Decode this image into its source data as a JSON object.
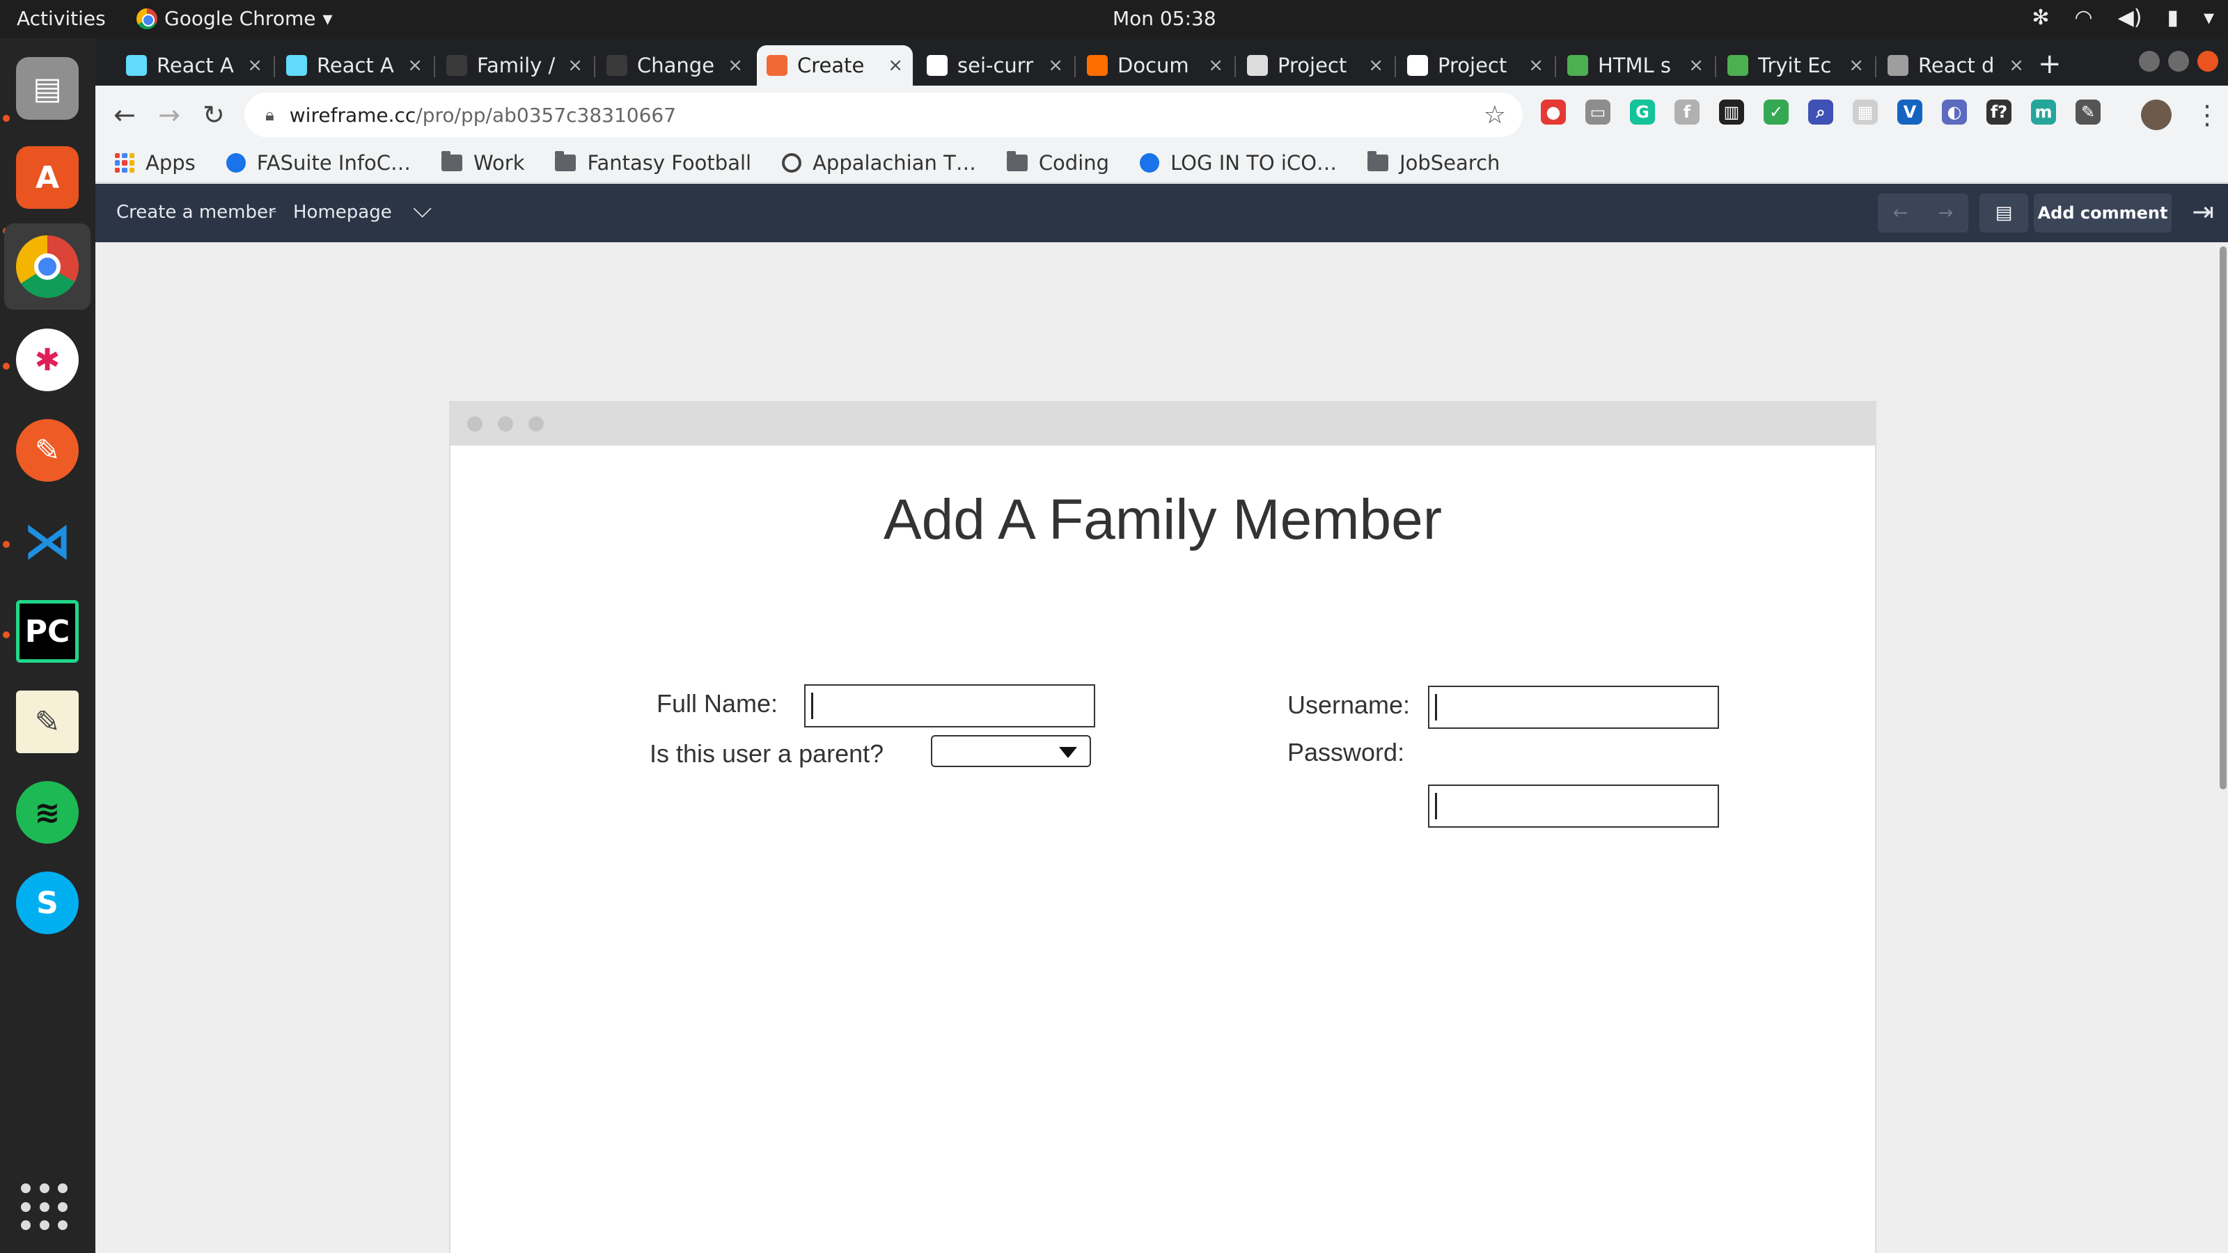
{
  "topbar": {
    "activities": "Activities",
    "app_name": "Google Chrome",
    "clock": "Mon 05:38",
    "tray_icons": [
      "slack-tray-icon",
      "wifi-icon",
      "volume-icon",
      "battery-icon",
      "chevron-down-icon"
    ]
  },
  "dock": {
    "items": [
      {
        "name": "files",
        "icon": "file-cabinet-icon"
      },
      {
        "name": "software",
        "icon": "software-bag-icon"
      },
      {
        "name": "chrome",
        "icon": "chrome-icon"
      },
      {
        "name": "slack",
        "icon": "slack-icon"
      },
      {
        "name": "postman",
        "icon": "postman-icon"
      },
      {
        "name": "vscode",
        "icon": "vscode-icon"
      },
      {
        "name": "pycharm",
        "icon": "pycharm-icon",
        "label": "PC"
      },
      {
        "name": "text-editor",
        "icon": "notepad-icon"
      },
      {
        "name": "spotify",
        "icon": "spotify-icon"
      },
      {
        "name": "skype",
        "icon": "skype-icon",
        "label": "S"
      }
    ]
  },
  "tabs": [
    {
      "title": "React A",
      "icon": "react-icon",
      "color": "#61dafb"
    },
    {
      "title": "React A",
      "icon": "react-icon",
      "color": "#61dafb"
    },
    {
      "title": "Family /",
      "icon": "blank-page-icon",
      "color": "#3a3a3a"
    },
    {
      "title": "Change",
      "icon": "blank-page-icon",
      "color": "#3a3a3a"
    },
    {
      "title": "Create",
      "icon": "wireframe-icon",
      "color": "#f06a35",
      "active": true
    },
    {
      "title": "sei-curr",
      "icon": "github-icon",
      "color": "#ffffff"
    },
    {
      "title": "Docum",
      "icon": "document-icon",
      "color": "#ff6d00"
    },
    {
      "title": "Project",
      "icon": "project-board-icon",
      "color": "#dddddd"
    },
    {
      "title": "Project",
      "icon": "github-icon",
      "color": "#ffffff"
    },
    {
      "title": "HTML s",
      "icon": "w3schools-icon",
      "color": "#4caf50"
    },
    {
      "title": "Tryit Ec",
      "icon": "w3schools-icon",
      "color": "#4caf50"
    },
    {
      "title": "React d",
      "icon": "cr-icon",
      "color": "#9e9e9e"
    }
  ],
  "tab_close": "×",
  "new_tab": "+",
  "address": {
    "host": "wireframe.cc",
    "path": "/pro/pp/ab0357c38310667"
  },
  "extensions": [
    {
      "icon": "adblock-icon",
      "color": "#e53935",
      "glyph": "●"
    },
    {
      "icon": "css-icon",
      "color": "#8d8d8d",
      "glyph": "▭"
    },
    {
      "icon": "grammarly-icon",
      "color": "#15c39a",
      "glyph": "G"
    },
    {
      "icon": "font-icon",
      "color": "#b0b0b0",
      "glyph": "f"
    },
    {
      "icon": "columns-icon",
      "color": "#222222",
      "glyph": "▥"
    },
    {
      "icon": "shield-check-icon",
      "color": "#34a853",
      "glyph": "✓"
    },
    {
      "icon": "magnifier-icon",
      "color": "#3f51b5",
      "glyph": "⌕"
    },
    {
      "icon": "grid-ext-icon",
      "color": "#cfcfcf",
      "glyph": "▦"
    },
    {
      "icon": "v-ext-icon",
      "color": "#1565c0",
      "glyph": "V"
    },
    {
      "icon": "orb-icon",
      "color": "#5c6bc0",
      "glyph": "◐"
    },
    {
      "icon": "function-icon",
      "color": "#333333",
      "glyph": "f?"
    },
    {
      "icon": "teal-circle-icon",
      "color": "#26a69a",
      "glyph": "m"
    },
    {
      "icon": "eyedropper-icon",
      "color": "#555555",
      "glyph": "✎"
    }
  ],
  "bookmarks": [
    {
      "label": "Apps",
      "icon": "apps-grid-icon"
    },
    {
      "label": "FASuite InfoC…",
      "icon": "fasuite-icon"
    },
    {
      "label": "Work",
      "icon": "folder-icon"
    },
    {
      "label": "Fantasy Football",
      "icon": "folder-icon"
    },
    {
      "label": "Appalachian T…",
      "icon": "globe-icon"
    },
    {
      "label": "Coding",
      "icon": "folder-icon"
    },
    {
      "label": "LOG IN TO iCO…",
      "icon": "icon-logo-icon"
    },
    {
      "label": "JobSearch",
      "icon": "folder-icon"
    }
  ],
  "wireframe_bar": {
    "crumb_page": "Create a member",
    "crumb_separator": "–",
    "crumb_home": "Homepage",
    "add_comment": "Add comment"
  },
  "form": {
    "title": "Add A Family Member",
    "full_name_label": "Full Name:",
    "full_name_value": "",
    "username_label": "Username:",
    "username_value": "",
    "parent_label": "Is this user a parent?",
    "parent_value": "",
    "password_label": "Password:",
    "password_value": ""
  }
}
